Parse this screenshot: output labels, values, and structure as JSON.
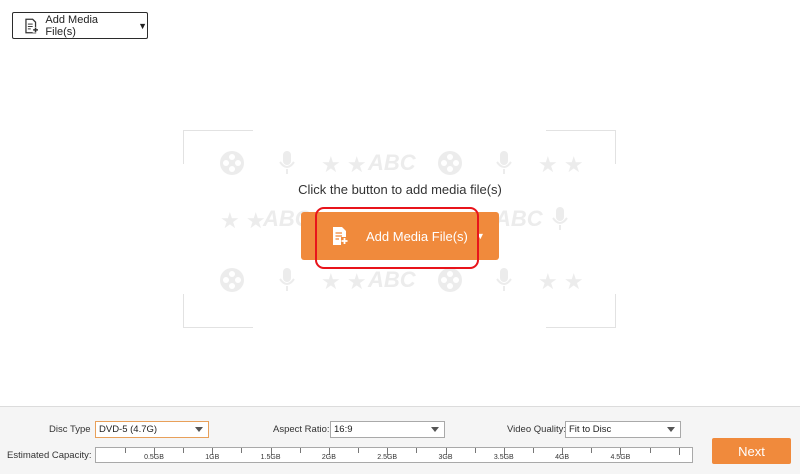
{
  "toolbar": {
    "add_media_label": "Add Media File(s)",
    "caret": "▼"
  },
  "main": {
    "hint": "Click the button to add media file(s)",
    "add_media_label": "Add Media File(s)",
    "caret": "▼",
    "pattern_text": "ABC"
  },
  "settings": {
    "disc_type_label": "Disc Type",
    "disc_type_value": "DVD-5 (4.7G)",
    "aspect_ratio_label": "Aspect Ratio:",
    "aspect_ratio_value": "16:9",
    "video_quality_label": "Video Quality:",
    "video_quality_value": "Fit to Disc",
    "capacity_label": "Estimated Capacity:",
    "capacity_ticks": [
      "0.5GB",
      "1GB",
      "1.5GB",
      "2GB",
      "2.5GB",
      "3GB",
      "3.5GB",
      "4GB",
      "4.5GB"
    ]
  },
  "actions": {
    "next_label": "Next"
  },
  "colors": {
    "accent": "#f08a3c",
    "highlight": "#e8141b"
  }
}
